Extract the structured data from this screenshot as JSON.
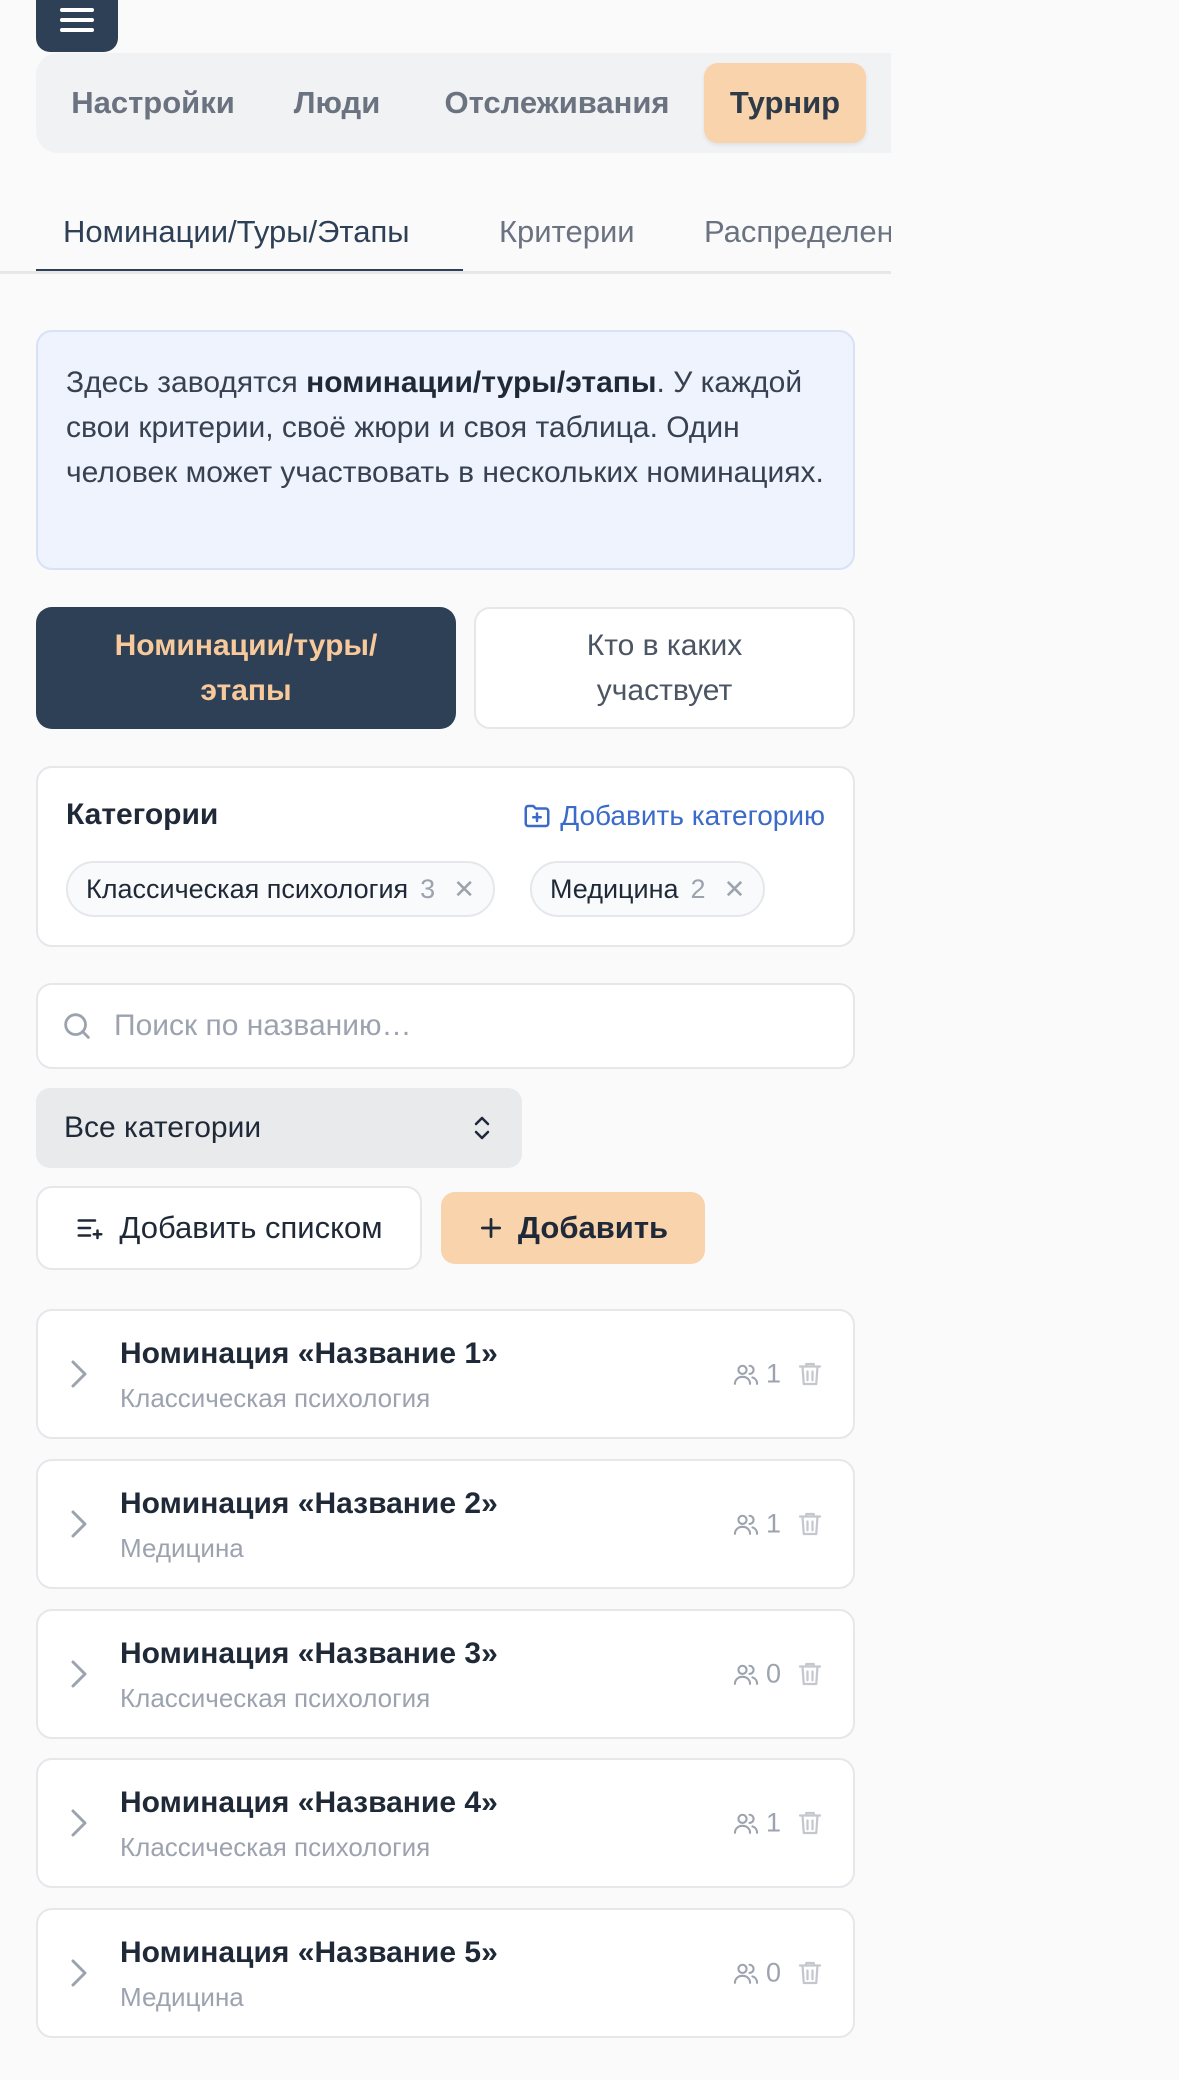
{
  "top_tabs": [
    "Настройки",
    "Люди",
    "Отслеживания",
    "Турнир"
  ],
  "sub_tabs": [
    "Номинации/Туры/Этапы",
    "Критерии",
    "Распределен"
  ],
  "info": {
    "pre": "Здесь заводятся ",
    "bold": "номинации/туры/этапы",
    "post": ". У каждой свои критерии, своё жюри и своя таблица. Один человек может участвовать в нескольких номинациях."
  },
  "segments": {
    "active": "Номинации/туры/этапы",
    "inactive": "Кто в каких участвует"
  },
  "categories": {
    "title": "Категории",
    "add_label": "Добавить категорию",
    "chips": [
      {
        "label": "Классическая психология",
        "count": "3"
      },
      {
        "label": "Медицина",
        "count": "2"
      }
    ]
  },
  "search": {
    "placeholder": "Поиск по названию…"
  },
  "filter": {
    "selected": "Все категории"
  },
  "actions": {
    "add_list": "Добавить списком",
    "add": "Добавить"
  },
  "items": [
    {
      "name": "Номинация «Название 1»",
      "category": "Классическая психология",
      "count": "1"
    },
    {
      "name": "Номинация «Название 2»",
      "category": "Медицина",
      "count": "1"
    },
    {
      "name": "Номинация «Название 3»",
      "category": "Классическая психология",
      "count": "0"
    },
    {
      "name": "Номинация «Название 4»",
      "category": "Классическая психология",
      "count": "1"
    },
    {
      "name": "Номинация «Название 5»",
      "category": "Медицина",
      "count": "0"
    }
  ],
  "colors": {
    "primary": "#2e4056",
    "accent": "#f8d3ac",
    "link": "#3b6ac9"
  }
}
